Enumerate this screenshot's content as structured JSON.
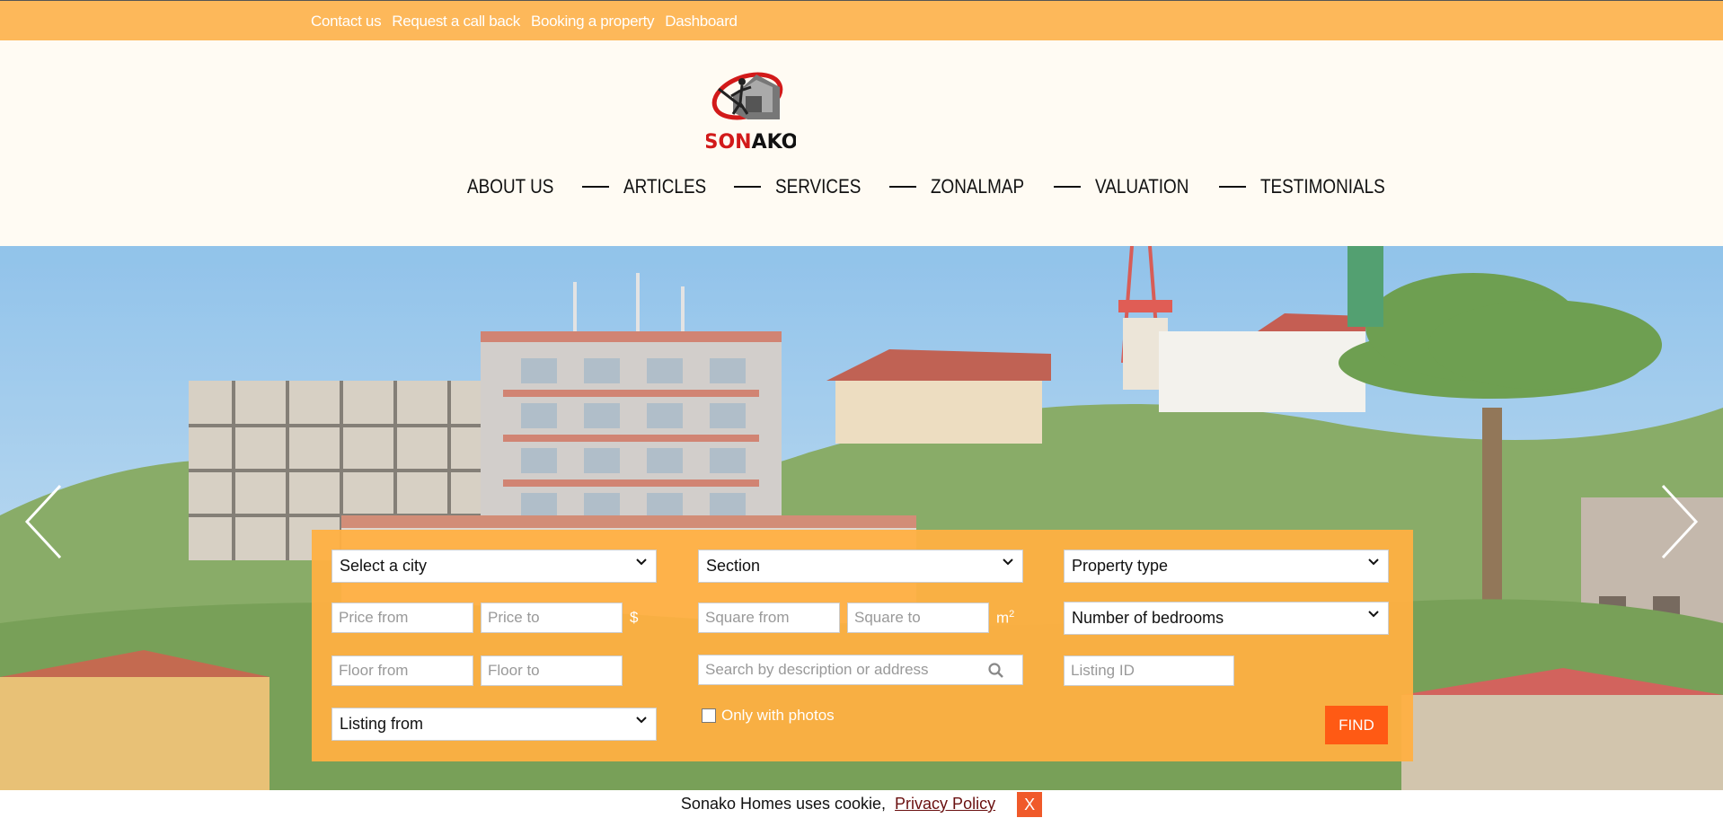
{
  "topbar": {
    "links": [
      "Contact us",
      "Request a call back",
      "Booking a property",
      "Dashboard"
    ]
  },
  "brand": {
    "logo_text": "SONAKO"
  },
  "nav": {
    "items": [
      "ABOUT US",
      "ARTICLES",
      "SERVICES",
      "ZONALMAP",
      "VALUATION",
      "TESTIMONIALS"
    ]
  },
  "search": {
    "city_select": "Select a city",
    "section_select": "Section",
    "property_type_select": "Property type",
    "price_from": "Price from",
    "price_to": "Price to",
    "price_unit": "$",
    "square_from": "Square from",
    "square_to": "Square to",
    "square_unit": "m",
    "square_unit_exp": "2",
    "bedrooms_select": "Number of bedrooms",
    "floor_from": "Floor from",
    "floor_to": "Floor to",
    "description_search": "Search by description or address",
    "listing_id": "Listing ID",
    "listing_from_select": "Listing from",
    "only_photos_label": "Only with photos",
    "find_button": "FIND"
  },
  "cookie": {
    "text": "Sonako Homes uses cookie,",
    "link": "Privacy Policy",
    "close": "X"
  },
  "colors": {
    "accent": "#fdb85a",
    "find": "#ff5a14",
    "close": "#f05a2a"
  }
}
